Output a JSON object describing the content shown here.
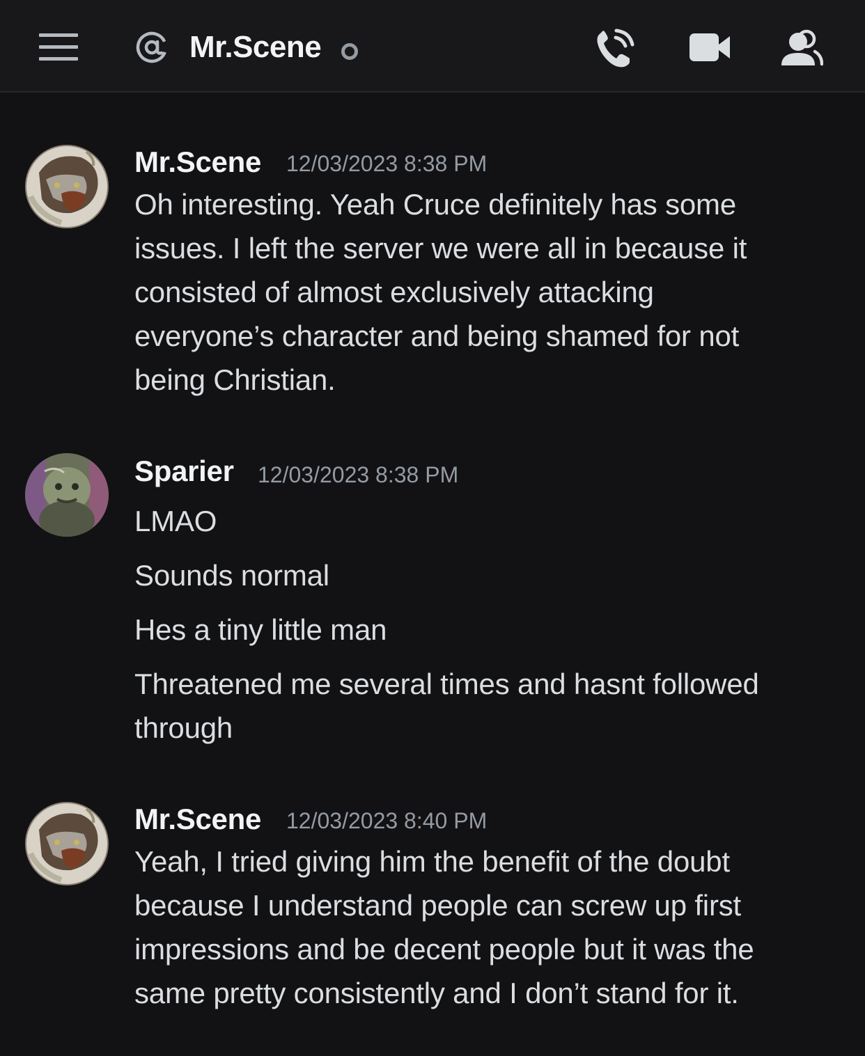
{
  "header": {
    "channel_name": "Mr.Scene",
    "status": "offline",
    "icons": [
      "menu-icon",
      "at-icon",
      "voice-call-icon",
      "video-call-icon",
      "members-icon"
    ]
  },
  "messages": [
    {
      "author": "Mr.Scene",
      "timestamp": "12/03/2023 8:38 PM",
      "lines": [
        "Oh interesting. Yeah Cruce definitely has some",
        "issues. I left the server we were all in because it",
        "consisted of almost exclusively attacking",
        "everyone’s character and being shamed for not",
        "being Christian."
      ]
    },
    {
      "author": "Sparier",
      "timestamp": "12/03/2023 8:38 PM",
      "lines": [
        "LMAO",
        "Sounds normal",
        "Hes a tiny little man",
        "Threatened me several times and hasnt followed",
        "through"
      ]
    },
    {
      "author": "Mr.Scene",
      "timestamp": "12/03/2023 8:40 PM",
      "lines": [
        "Yeah, I tried giving him the benefit of the doubt",
        "because I understand people can screw up first",
        "impressions and be decent people but it was the",
        "same pretty consistently and I don’t stand for it."
      ]
    }
  ],
  "colors": {
    "background": "#121214",
    "header": "#18181b",
    "username": "#f2f3f5",
    "timestamp": "#949ba4",
    "text": "#dbdee1"
  }
}
